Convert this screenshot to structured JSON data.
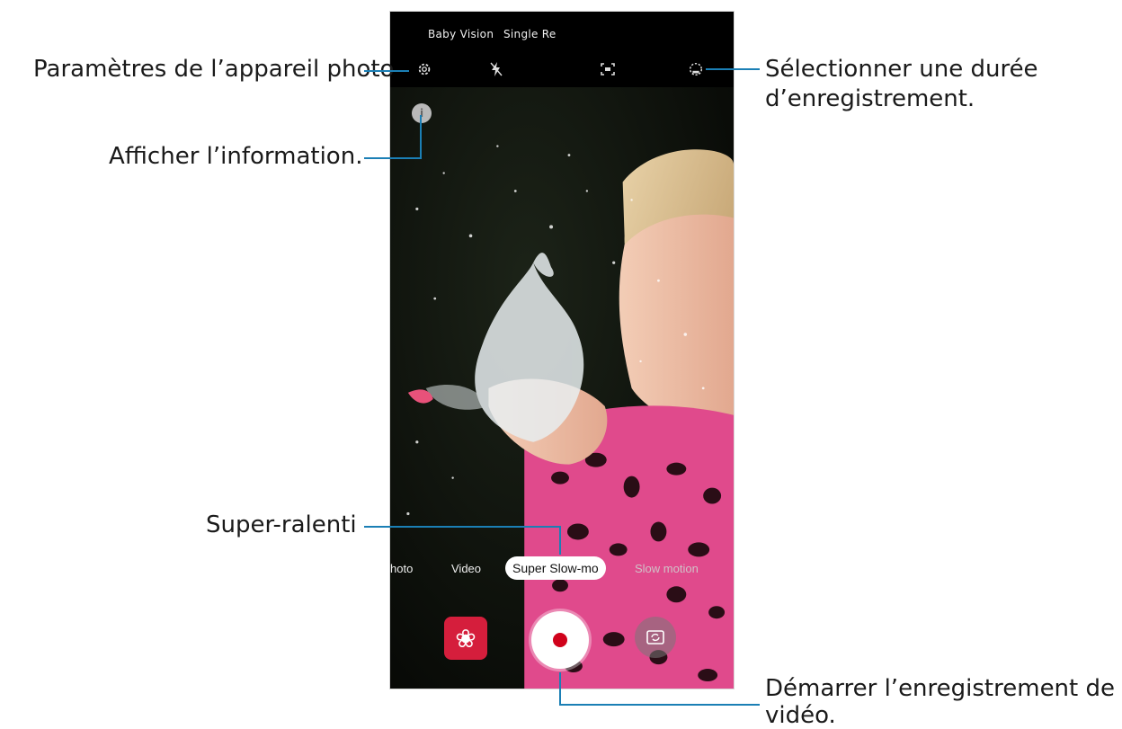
{
  "callouts": {
    "settings": "Paramètres de l’appareil photo",
    "info": "Afficher l’information.",
    "duration_line1": "Sélectionner une durée",
    "duration_line2": "d’enregistrement.",
    "super_slow": "Super-ralenti",
    "record_line1": "Démarrer l’enregistrement de la",
    "record_line2": "vidéo."
  },
  "phone": {
    "top_modes": [
      "Baby Vision",
      "Single Re"
    ],
    "top_icons": [
      "settings-gear-icon",
      "flash-off-icon",
      "auto-detection-icon",
      "recording-duration-icon"
    ],
    "info_label": "i",
    "modes": {
      "photo": "hoto",
      "video": "Video",
      "super_slow": "Super Slow-mo",
      "slow_motion": "Slow motion"
    },
    "gallery_icon": "❀",
    "colors": {
      "accent_leader": "#1b7fb5",
      "gallery": "#d51e3c",
      "record_dot": "#d0021b"
    }
  }
}
